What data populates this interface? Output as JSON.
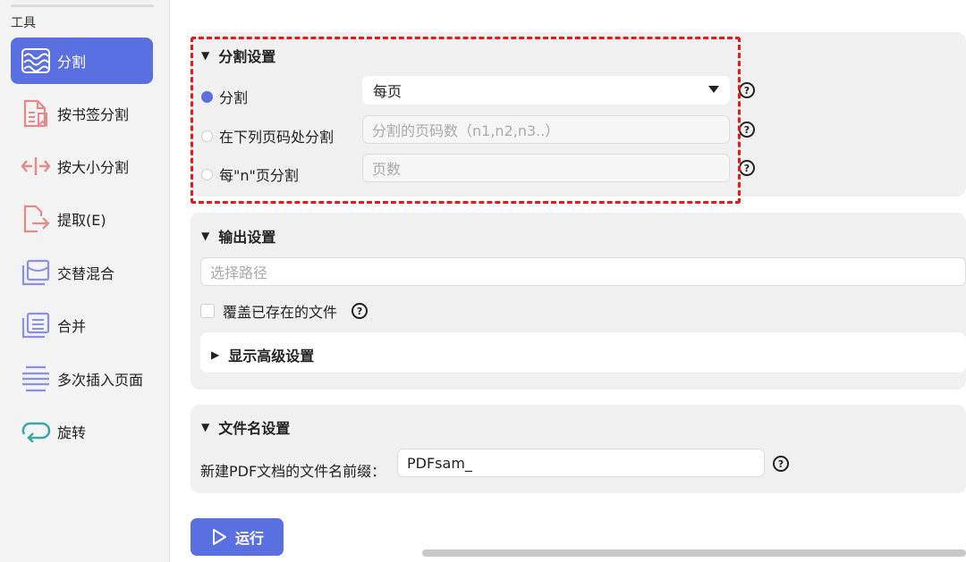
{
  "sidebar": {
    "title": "工具",
    "items": [
      {
        "label": "分割",
        "icon": "split-wave-icon",
        "active": true
      },
      {
        "label": "按书签分割",
        "icon": "bookmark-split-icon"
      },
      {
        "label": "按大小分割",
        "icon": "size-split-icon"
      },
      {
        "label": "提取(E)",
        "icon": "extract-icon"
      },
      {
        "label": "交替混合",
        "icon": "alternate-mix-icon"
      },
      {
        "label": "合并",
        "icon": "merge-icon"
      },
      {
        "label": "多次插入页面",
        "icon": "insert-pages-icon"
      },
      {
        "label": "旋转",
        "icon": "rotate-icon"
      }
    ]
  },
  "split_settings": {
    "title": "分割设置",
    "option_split": "分割",
    "option_split_value": "每页",
    "option_pages": "在下列页码处分割",
    "option_pages_placeholder": "分割的页码数（n1,n2,n3..）",
    "option_every_n": "每\"n\"页分割",
    "option_every_n_placeholder": "页数"
  },
  "output_settings": {
    "title": "输出设置",
    "path_placeholder": "选择路径",
    "overwrite_label": "覆盖已存在的文件",
    "advanced_title": "显示高级设置"
  },
  "filename_settings": {
    "title": "文件名设置",
    "prefix_label": "新建PDF文档的文件名前缀：",
    "prefix_value": "PDFsam_"
  },
  "run_label": "运行",
  "help_glyph": "?",
  "colors": {
    "accent": "#5a6fe0",
    "highlight": "#e6191b"
  }
}
